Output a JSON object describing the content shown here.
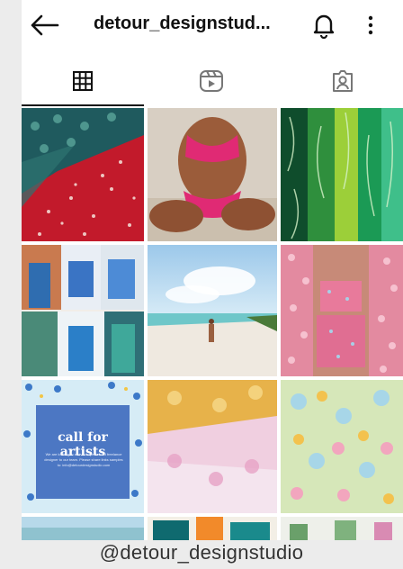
{
  "header": {
    "username": "detour_designstud...",
    "back_icon": "arrow-left-icon",
    "notification_icon": "bell-icon",
    "more_icon": "more-vertical-icon"
  },
  "tabs": [
    {
      "icon": "grid-icon",
      "active": true
    },
    {
      "icon": "reels-icon",
      "active": false
    },
    {
      "icon": "tagged-icon",
      "active": false
    }
  ],
  "posts": [
    {
      "id": "red-floral-fabric"
    },
    {
      "id": "pink-bikini"
    },
    {
      "id": "green-leaf-prints"
    },
    {
      "id": "blue-fashion-collage"
    },
    {
      "id": "beach-walk"
    },
    {
      "id": "pink-floral-set"
    },
    {
      "id": "call-for-artists",
      "title": "call for artists",
      "body": "We are looking to add an experienced freelance designer to our team. Please share links samples to: info@detourdesignstudio.com"
    },
    {
      "id": "yellow-pink-fabric"
    },
    {
      "id": "pastel-floral-fabric"
    }
  ],
  "caption": "@detour_designstudio"
}
